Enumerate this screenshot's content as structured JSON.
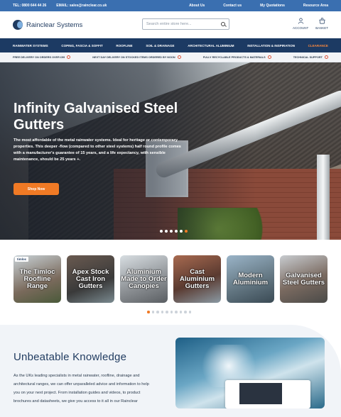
{
  "topbar": {
    "tel": "TEL: 0800 644 44 26",
    "email": "EMAIL: sales@rainclear.co.uk",
    "links": [
      "About Us",
      "Contact us",
      "My Quotations",
      "Resource Area"
    ]
  },
  "header": {
    "brand": "Rainclear Systems",
    "search_placeholder": "Search entire store here...",
    "account": "ACCOUNT",
    "basket": "BASKET"
  },
  "nav": [
    "RAINWATER SYSTEMS",
    "COPING, FASCIA & SOFFIT",
    "ROOFLINE",
    "SOIL & DRAINAGE",
    "ARCHITECTURAL ALUMINIUM",
    "INSTALLATION & INSPIRATION",
    "CLEARANCE"
  ],
  "usp": [
    "FREE DELIVERY ON ORDERS OVER £99",
    "NEXT DAY DELIVERY ON STOCKED ITEMS ORDERED BY NOON",
    "FULLY RECYCLABLE PRODUCTS & MATERIALS",
    "TECHNICAL SUPPORT"
  ],
  "hero": {
    "title": "Infinity Galvanised Steel Gutters",
    "body": "The most affordable of the metal rainwater systems. Ideal for heritage or contemporary properties. This deeper -flow (compared to other steel systems) half round profile comes with a manufacturer's guarantee of 15 years, and a life expectancy, with sensible maintenance, should be 25 years +.",
    "cta": "Shop Now",
    "slide_count": 6,
    "active_slide": 5
  },
  "categories": [
    {
      "label": "The Timloc Roofline Range",
      "badge": "timloc"
    },
    {
      "label": "Apex Stock Cast Iron Gutters"
    },
    {
      "label": "Aluminium Made to Order Canopies"
    },
    {
      "label": "Cast Aluminium Gutters"
    },
    {
      "label": "Modern Aluminium"
    },
    {
      "label": "Galvanised Steel Gutters"
    }
  ],
  "category_pages": 10,
  "category_active": 0,
  "knowledge": {
    "title": "Unbeatable Knowledge",
    "body": "As the UKs leading specialists in metal rainwater, roofline, drainage and architectural ranges, we can offer unparalleled advice and information to help you on your next project. From installation guides and videos, to product brochures and datasheets, we give you access to it all in our Rainclear"
  },
  "colors": {
    "topbar": "#3a6fb0",
    "nav": "#1c3a63",
    "accent": "#f07a25",
    "clearance": "#ff8a3d"
  }
}
